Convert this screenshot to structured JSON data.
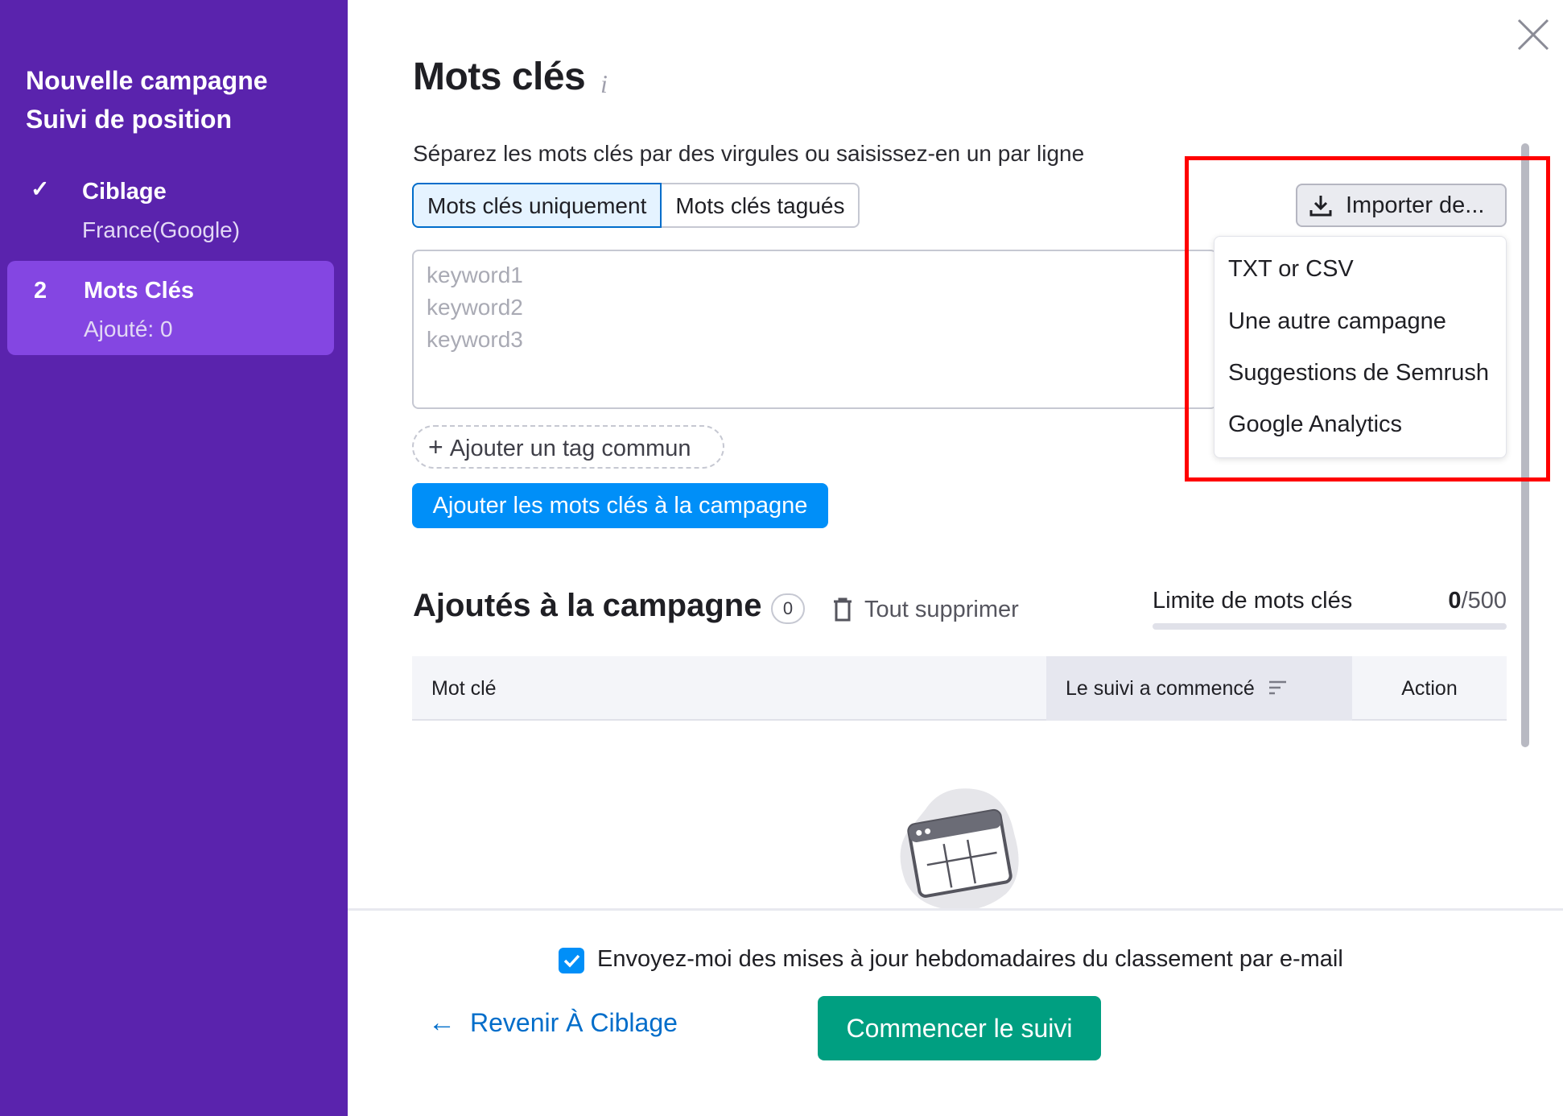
{
  "sidebar": {
    "title_line1": "Nouvelle campagne",
    "title_line2": "Suivi de position",
    "steps": [
      {
        "mark": "✓",
        "name": "Ciblage",
        "sub": "France(Google)"
      },
      {
        "mark": "2",
        "name": "Mots Clés",
        "sub": "Ajouté: 0"
      }
    ]
  },
  "main": {
    "title": "Mots clés",
    "info_icon": "i",
    "instructions": "Séparez les mots clés par des virgules ou saisissez-en un par ligne",
    "tabs": [
      "Mots clés uniquement",
      "Mots clés tagués"
    ],
    "keyword_placeholder_lines": [
      "keyword1",
      "keyword2",
      "keyword3"
    ],
    "add_tag_label": "Ajouter un tag commun",
    "add_button_label": "Ajouter les mots clés à la campagne",
    "import_button_label": "Importer de...",
    "import_options": [
      "TXT or CSV",
      "Une autre campagne",
      "Suggestions de Semrush",
      "Google Analytics"
    ],
    "section_title": "Ajoutés à la campagne",
    "added_count": "0",
    "delete_all_label": "Tout supprimer",
    "limit_label": "Limite de mots clés",
    "limit_used": "0",
    "limit_total": "/500",
    "limit_fraction": 0,
    "table_headers": [
      "Mot clé",
      "Le suivi a commencé",
      "Action"
    ]
  },
  "footer": {
    "email_checkbox_checked": true,
    "email_checkbox_label": "Envoyez-moi des mises à jour hebdomadaires du classement par e-mail",
    "back_label": "Revenir À Ciblage",
    "start_label": "Commencer le suivi"
  },
  "colors": {
    "sidebar_bg": "#5a23ad",
    "active_step_bg": "#8446e2",
    "primary_blue": "#008ff8",
    "start_green": "#009f81",
    "highlight_red": "#ff0000"
  }
}
